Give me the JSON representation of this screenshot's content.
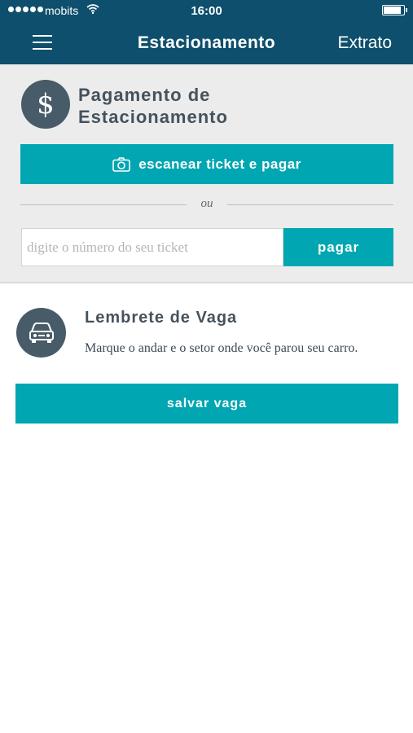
{
  "status_bar": {
    "carrier": "mobits",
    "time": "16:00"
  },
  "nav": {
    "title": "Estacionamento",
    "action_label": "Extrato"
  },
  "payment": {
    "icon_symbol": "$",
    "title": "Pagamento de Estacionamento",
    "scan_button_label": "escanear ticket e pagar",
    "divider_text": "ou",
    "ticket_placeholder": "digite o número do seu ticket",
    "ticket_value": "",
    "pay_button_label": "pagar"
  },
  "reminder": {
    "title": "Lembrete de Vaga",
    "description": "Marque o andar e o setor onde você parou seu carro.",
    "save_button_label": "salvar vaga"
  },
  "colors": {
    "header": "#0d4f6c",
    "accent": "#00a6b1",
    "icon_circle": "#475b68"
  },
  "icons": [
    "menu-icon",
    "wifi-icon",
    "battery-icon",
    "dollar-icon",
    "camera-icon",
    "car-icon"
  ]
}
